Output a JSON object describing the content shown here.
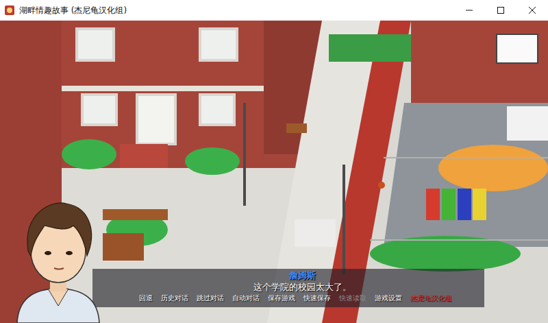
{
  "window": {
    "title": "湖畔情趣故事 (杰尼龟汉化组)"
  },
  "dialogue": {
    "speaker": "詹姆斯",
    "text": "这个学院的校园太大了。"
  },
  "quick_menu": [
    {
      "label": "回退",
      "disabled": false,
      "color": "#ffffff"
    },
    {
      "label": "历史对话",
      "disabled": false,
      "color": "#ffffff"
    },
    {
      "label": "跳过对话",
      "disabled": false,
      "color": "#ffffff"
    },
    {
      "label": "自动对话",
      "disabled": false,
      "color": "#ffffff"
    },
    {
      "label": "保存游戏",
      "disabled": false,
      "color": "#ffffff"
    },
    {
      "label": "快速保存",
      "disabled": false,
      "color": "#ffffff"
    },
    {
      "label": "快速读取",
      "disabled": true,
      "color": "#8a8a8a"
    },
    {
      "label": "游戏设置",
      "disabled": false,
      "color": "#ffffff"
    },
    {
      "label": "杰尼龟汉化组",
      "disabled": false,
      "color": "#e53030"
    }
  ]
}
